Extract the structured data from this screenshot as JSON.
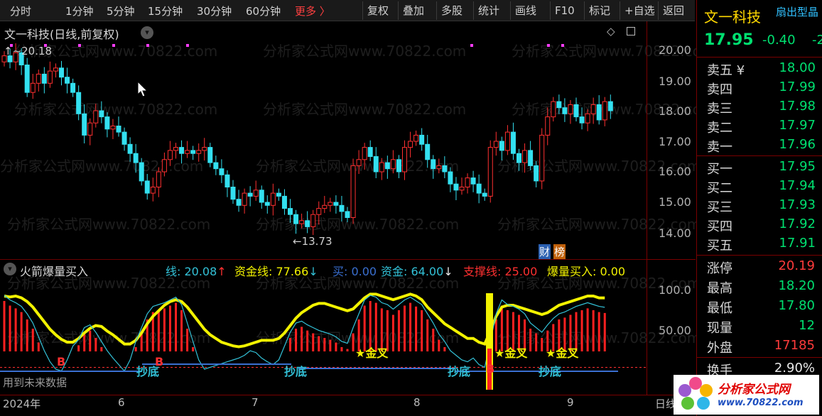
{
  "toolbar": {
    "periods": [
      "分时",
      "1分钟",
      "5分钟",
      "15分钟",
      "30分钟",
      "60分钟"
    ],
    "more": "更多 〉",
    "buttons": [
      "复权",
      "叠加",
      "多股",
      "统计",
      "画线",
      "F10",
      "标记",
      "+自选",
      "返回"
    ]
  },
  "main_chart": {
    "title": "文一科技(日线,前复权)",
    "high_label": "20.18",
    "low_label": "13.73",
    "y_ticks": [
      "20.00",
      "19.00",
      "18.00",
      "17.00",
      "16.00",
      "15.00",
      "14.00"
    ],
    "badge": [
      "财",
      "榜"
    ]
  },
  "indicator": {
    "name": "火箭爆量买入",
    "values": [
      {
        "label": "线:",
        "value": "20.08",
        "arrow": "↑",
        "color": "#33c2d8",
        "arrow_color": "#ff3030"
      },
      {
        "label": "资金线:",
        "value": "77.66",
        "arrow": "↓",
        "color": "#f2f200",
        "arrow_color": "#33c2d8"
      },
      {
        "label": "买:",
        "value": "0.00",
        "arrow": "",
        "color": "#3a6fd0",
        "arrow_color": ""
      },
      {
        "label": "资金:",
        "value": "64.00",
        "arrow": "↓",
        "color": "#33c2d8",
        "arrow_color": "#e8e8e8"
      },
      {
        "label": "支撑线:",
        "value": "25.00",
        "arrow": "",
        "color": "#ff3030",
        "arrow_color": ""
      },
      {
        "label": "爆量买入:",
        "value": "0.00",
        "arrow": "",
        "color": "#f2f200",
        "arrow_color": ""
      }
    ],
    "y_ticks": [
      "100.0",
      "50.00"
    ],
    "signals": [
      "B",
      "抄底",
      "B",
      "抄底",
      "★金叉",
      "抄底",
      "B",
      "★金叉",
      "抄底",
      "★金叉"
    ],
    "note": "用到未来数据"
  },
  "dates": [
    "2024年",
    "6",
    "7",
    "8",
    "9",
    "日线"
  ],
  "quote": {
    "name": "文一科技",
    "tag": "扇出型晶",
    "price": "17.95",
    "change": "-0.40",
    "change_pct": "-2",
    "asks": [
      {
        "label": "卖五 ¥",
        "price": "18.00"
      },
      {
        "label": "卖四",
        "price": "17.99"
      },
      {
        "label": "卖三",
        "price": "17.98"
      },
      {
        "label": "卖二",
        "price": "17.97"
      },
      {
        "label": "卖一",
        "price": "17.96"
      }
    ],
    "bids": [
      {
        "label": "买一",
        "price": "17.95"
      },
      {
        "label": "买二",
        "price": "17.94"
      },
      {
        "label": "买三",
        "price": "17.93"
      },
      {
        "label": "买四",
        "price": "17.92"
      },
      {
        "label": "买五",
        "price": "17.91"
      }
    ],
    "stats": [
      {
        "label": "涨停",
        "value": "20.19",
        "color": "#ff3b3b"
      },
      {
        "label": "最高",
        "value": "18.20",
        "color": "#00e070"
      },
      {
        "label": "最低",
        "value": "17.80",
        "color": "#00e070"
      },
      {
        "label": "现量",
        "value": "12",
        "color": "#00e070"
      },
      {
        "label": "外盘",
        "value": "17185",
        "color": "#ff3b3b"
      },
      {
        "label": "换手",
        "value": "2.90%",
        "color": "#e8e8e8"
      }
    ]
  },
  "watermark": {
    "text": "分析家公式网www.70822.com",
    "logo_title": "分析家公式网",
    "logo_url": "www.70822.com"
  },
  "colors": {
    "up": "#ff3030",
    "down": "#33e0f0",
    "line_yellow": "#f2f200",
    "line_cyan": "#33c2d8"
  }
}
